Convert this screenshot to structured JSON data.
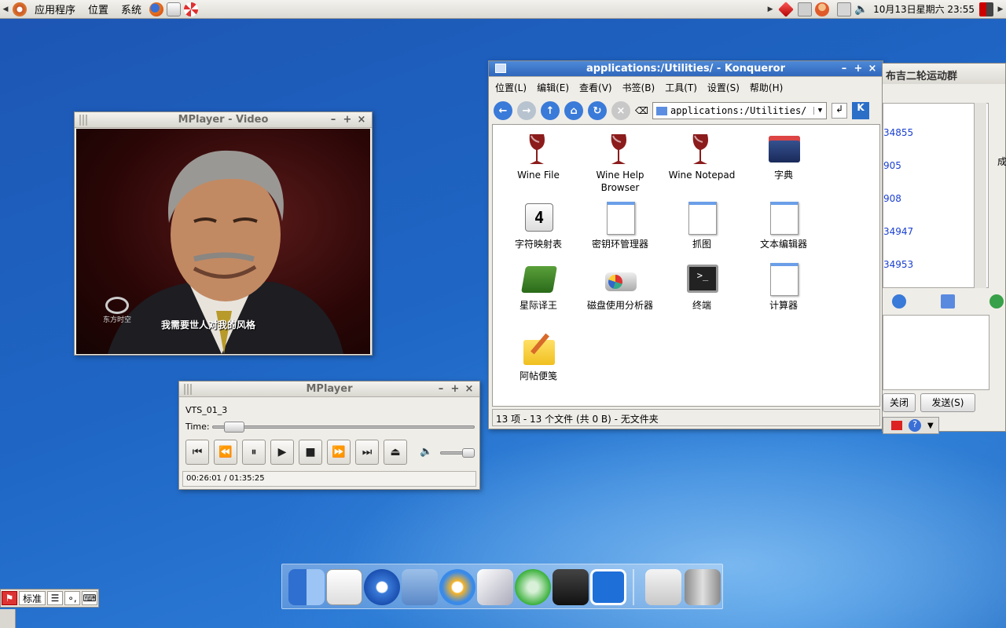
{
  "top_panel": {
    "applications": "应用程序",
    "places": "位置",
    "system": "系统",
    "clock": "10月13日星期六 23:55"
  },
  "video_window": {
    "title": "MPlayer - Video",
    "subtitle": "我需要世人对我的风格",
    "channel_logo": "东方时空"
  },
  "control_window": {
    "title": "MPlayer",
    "track": "VTS_01_3",
    "time_label": "Time:",
    "position": "00:26:01",
    "duration": "01:35:25",
    "time_progress": 0.27,
    "volume": 0.75
  },
  "konqueror": {
    "title": "applications:/Utilities/ - Konqueror",
    "menu": [
      "位置(L)",
      "编辑(E)",
      "查看(V)",
      "书签(B)",
      "工具(T)",
      "设置(S)",
      "帮助(H)"
    ],
    "location": "applications:/Utilities/",
    "items": [
      {
        "label": "Wine File",
        "icon": "wine-icon"
      },
      {
        "label": "Wine Help Browser",
        "icon": "wine-icon"
      },
      {
        "label": "Wine Notepad",
        "icon": "wine-icon"
      },
      {
        "label": "字典",
        "icon": "dictionary-icon"
      },
      {
        "label": "字符映射表",
        "icon": "charmap-icon"
      },
      {
        "label": "密钥环管理器",
        "icon": "document-icon"
      },
      {
        "label": "抓图",
        "icon": "document-icon"
      },
      {
        "label": "文本编辑器",
        "icon": "document-icon"
      },
      {
        "label": "星际译王",
        "icon": "books-icon"
      },
      {
        "label": "磁盘使用分析器",
        "icon": "disk-icon"
      },
      {
        "label": "终端",
        "icon": "terminal-icon"
      },
      {
        "label": "计算器",
        "icon": "document-icon"
      },
      {
        "label": "阿帖便笺",
        "icon": "notes-icon"
      }
    ],
    "status": "13 项 - 13 个文件 (共 0 B) - 无文件夹"
  },
  "chat": {
    "title": "布吉二轮运动群",
    "ids": [
      "34855",
      "905",
      "908",
      "34947",
      "34953"
    ],
    "close": "关闭",
    "send": "发送(S)",
    "side_labels": [
      "成"
    ]
  },
  "input_bar": {
    "mode": "标准"
  },
  "colors": {
    "konq_title": "#3572c6",
    "link": "#1a3fd0"
  }
}
